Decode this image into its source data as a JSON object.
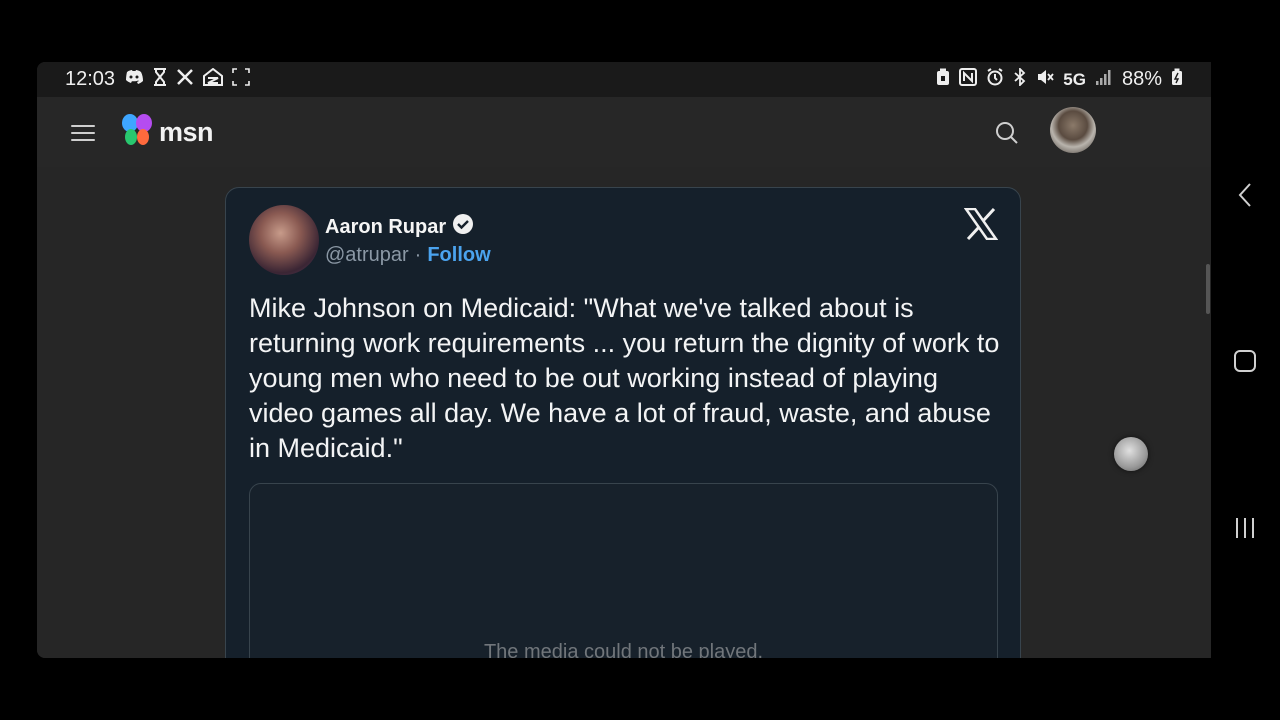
{
  "status_bar": {
    "time": "12:03",
    "battery": "88%",
    "network": "5G",
    "left_icons": [
      "discord-icon",
      "hourglass-icon",
      "x-icon",
      "zillow-icon",
      "screenshot-icon"
    ],
    "right_icons": [
      "lock-battery-icon",
      "nfc-icon",
      "alarm-icon",
      "bluetooth-icon",
      "mute-icon",
      "signal-icon",
      "battery-icon"
    ]
  },
  "app_bar": {
    "logo_text": "msn",
    "menu_icon": "hamburger-icon",
    "search_icon": "search-icon"
  },
  "tweet": {
    "author_name": "Aaron Rupar",
    "handle": "@atrupar",
    "separator": "·",
    "follow_label": "Follow",
    "text": "Mike Johnson on Medicaid: \"What we've talked about is returning work requirements ... you return the dignity of work to young men who need to be out working instead of playing video games all day. We have a lot of fraud, waste, and abuse in Medicaid.\"",
    "media_message": "The media could not be played.",
    "colors": {
      "background": "#15202b",
      "follow": "#4ba3ee",
      "handle": "#8b98a5"
    }
  },
  "nav_bar": {
    "back_icon": "back-chevron-icon",
    "home_icon": "home-square-icon",
    "recents_icon": "recents-icon"
  }
}
